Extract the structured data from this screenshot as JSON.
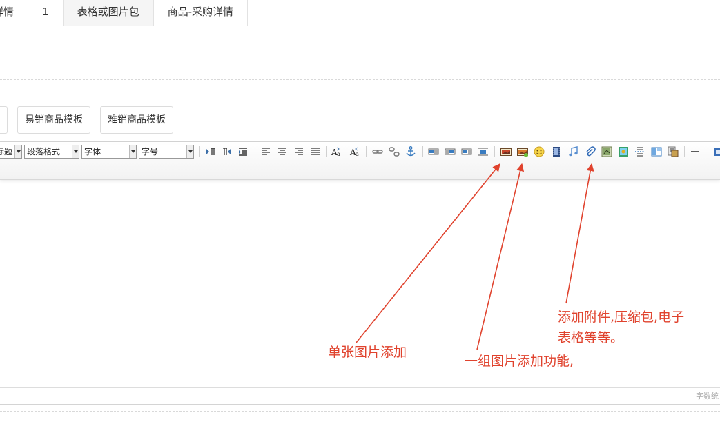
{
  "tabs": [
    "详情",
    "1",
    "表格或图片包",
    "商品-采购详情"
  ],
  "templates": [
    "易销商品模板",
    "难销商品模板"
  ],
  "toolbar": {
    "heading": "标题",
    "paragraph": "段落格式",
    "font": "字体",
    "size": "字号"
  },
  "status": {
    "word_count": "字数统"
  },
  "annotations": {
    "single": "单张图片添加",
    "group": "一组图片添加功能,",
    "attach_line1": "添加附件,压缩包,电子",
    "attach_line2": "表格等等。"
  },
  "colors": {
    "annotation": "#e0432e"
  }
}
